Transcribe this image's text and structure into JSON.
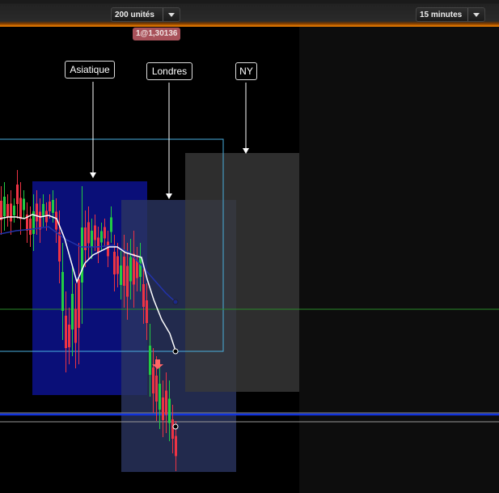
{
  "toolbar": {
    "quantity": "200 unités",
    "timeframe": "15 minutes"
  },
  "order_tag": "1@1,30136",
  "sessions": {
    "asian": "Asiatique",
    "london": "Londres",
    "ny": "NY"
  },
  "colors": {
    "toolbar_accent": "#ff8800",
    "bull_candle": "#22cc44",
    "bear_candle": "#ee3344",
    "moving_average_fast": "#ffffff",
    "moving_average_slow": "#2233aa",
    "asian_zone": "#0a0f78",
    "london_zone": "#2a3560",
    "ny_zone": "#3a3a3a",
    "horizontal_line": "#1133dd",
    "support_line": "#2a8a2a",
    "sell_arrow": "#ff6666"
  },
  "icons": {
    "dropdown": "chevron-down-icon",
    "sell_marker": "sell-arrow-icon"
  }
}
